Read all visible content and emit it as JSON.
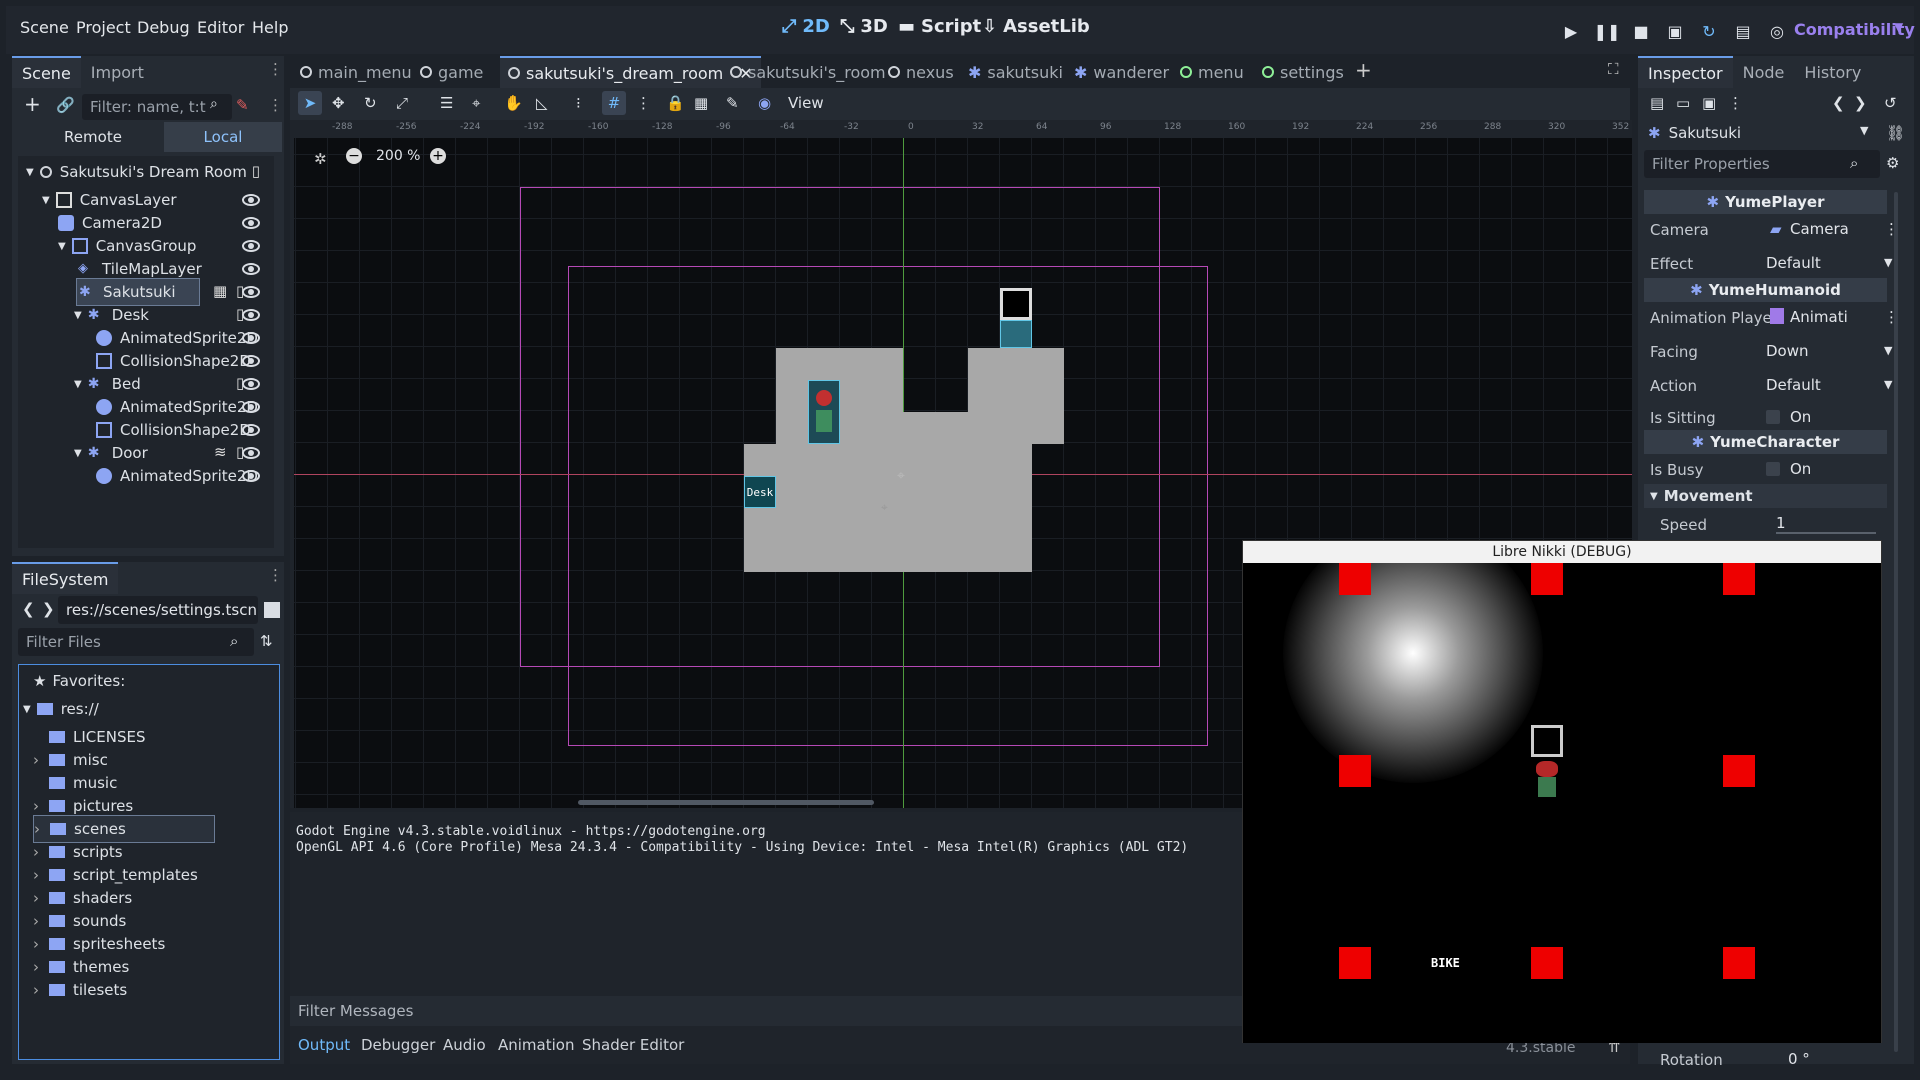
{
  "menu": [
    "Scene",
    "Project",
    "Debug",
    "Editor",
    "Help"
  ],
  "workspaces": {
    "w2d": "2D",
    "w3d": "3D",
    "script": "Script",
    "assetlib": "AssetLib"
  },
  "renderer": "Compatibility",
  "scene_dock": {
    "tabs": [
      "Scene",
      "Import"
    ],
    "filter_placeholder": "Filter: name, t:t",
    "remote": "Remote",
    "local": "Local",
    "tree": [
      {
        "label": "Sakutsuki's Dream Room",
        "depth": 0
      },
      {
        "label": "CanvasLayer",
        "depth": 1
      },
      {
        "label": "Camera2D",
        "depth": 2
      },
      {
        "label": "CanvasGroup",
        "depth": 2
      },
      {
        "label": "TileMapLayer",
        "depth": 3
      },
      {
        "label": "Sakutsuki",
        "depth": 3
      },
      {
        "label": "Desk",
        "depth": 3
      },
      {
        "label": "AnimatedSprite2D",
        "depth": 4
      },
      {
        "label": "CollisionShape2D",
        "depth": 4
      },
      {
        "label": "Bed",
        "depth": 3
      },
      {
        "label": "AnimatedSprite2D",
        "depth": 4
      },
      {
        "label": "CollisionShape2D",
        "depth": 4
      },
      {
        "label": "Door",
        "depth": 3
      },
      {
        "label": "AnimatedSprite2D",
        "depth": 4
      }
    ]
  },
  "filesystem": {
    "tab": "FileSystem",
    "path": "res://scenes/settings.tscn",
    "filter_placeholder": "Filter Files",
    "favorites": "Favorites:",
    "root": "res://",
    "items": [
      "LICENSES",
      "misc",
      "music",
      "pictures",
      "scenes",
      "scripts",
      "script_templates",
      "shaders",
      "sounds",
      "spritesheets",
      "themes",
      "tilesets"
    ]
  },
  "editor_tabs": [
    {
      "label": "main_menu",
      "type": "scene"
    },
    {
      "label": "game",
      "type": "scene"
    },
    {
      "label": "sakutsuki's_dream_room",
      "type": "scene",
      "active": true
    },
    {
      "label": "sakutsuki's_room",
      "type": "scene"
    },
    {
      "label": "nexus",
      "type": "scene"
    },
    {
      "label": "sakutsuki",
      "type": "char"
    },
    {
      "label": "wanderer",
      "type": "char"
    },
    {
      "label": "menu",
      "type": "green"
    },
    {
      "label": "settings",
      "type": "green"
    }
  ],
  "toolbar": {
    "view": "View"
  },
  "zoom": "200 %",
  "ruler_ticks": [
    "-288",
    "-256",
    "-224",
    "-192",
    "-160",
    "-128",
    "-96",
    "-64",
    "-32",
    "0",
    "32",
    "64",
    "96",
    "128",
    "160",
    "192",
    "224",
    "256",
    "288",
    "320",
    "352"
  ],
  "desk_label": "Desk",
  "output": {
    "lines": [
      "Godot Engine v4.3.stable.voidlinux - https://godotengine.org",
      "OpenGL API 4.6 (Core Profile) Mesa 24.3.4 - Compatibility - Using Device: Intel - Mesa Intel(R) Graphics (ADL GT2)"
    ],
    "filter": "Filter Messages",
    "tabs": [
      "Output",
      "Debugger",
      "Audio",
      "Animation",
      "Shader Editor"
    ],
    "version": "4.3.stable"
  },
  "inspector": {
    "tabs": [
      "Inspector",
      "Node",
      "History"
    ],
    "node": "Sakutsuki",
    "filter_placeholder": "Filter Properties",
    "sections": {
      "player": "YumePlayer",
      "humanoid": "YumeHumanoid",
      "character": "YumeCharacter",
      "movement": "Movement"
    },
    "props": {
      "camera": {
        "label": "Camera",
        "value": "Camera"
      },
      "effect": {
        "label": "Effect",
        "value": "Default"
      },
      "anim": {
        "label": "Animation Playe",
        "value": "Animati"
      },
      "facing": {
        "label": "Facing",
        "value": "Down"
      },
      "action": {
        "label": "Action",
        "value": "Default"
      },
      "sitting": {
        "label": "Is Sitting",
        "value": "On"
      },
      "busy": {
        "label": "Is Busy",
        "value": "On"
      },
      "speed": {
        "label": "Speed",
        "value": "1"
      },
      "rotation": {
        "label": "Rotation",
        "value": "0 °"
      }
    }
  },
  "game_window": {
    "title": "Libre Nikki (DEBUG)",
    "bike_label": "BIKE"
  }
}
